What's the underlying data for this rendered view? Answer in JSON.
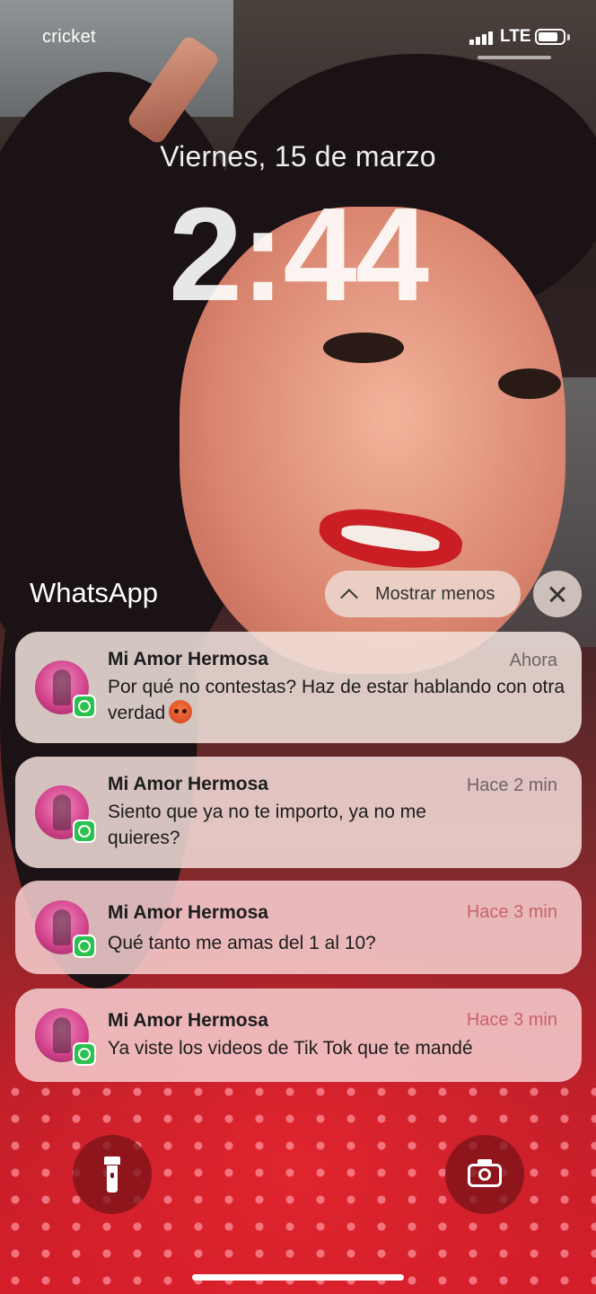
{
  "status_bar": {
    "carrier": "cricket",
    "network": "LTE",
    "signal_bars": 4,
    "battery_level": 0.8
  },
  "lock_screen": {
    "date": "Viernes, 15 de marzo",
    "time": "2:44"
  },
  "notification_group": {
    "app_name": "WhatsApp",
    "show_less_label": "Mostrar menos",
    "close_icon": "close-icon",
    "notifications": [
      {
        "sender": "Mi Amor Hermosa",
        "time": "Ahora",
        "message": "Por qué no contestas? Haz de estar hablando con otra verdad",
        "emoji": "angry-face-emoji"
      },
      {
        "sender": "Mi Amor Hermosa",
        "time": "Hace 2 min",
        "message": "Siento que ya no te importo, ya no me quieres?"
      },
      {
        "sender": "Mi Amor Hermosa",
        "time": "Hace 3 min",
        "message": "Qué tanto me amas del 1 al 10?"
      },
      {
        "sender": "Mi Amor Hermosa",
        "time": "Hace 3 min",
        "message": "Ya viste los videos de Tik Tok que te mandé"
      }
    ]
  },
  "quick_actions": {
    "left_icon": "flashlight-icon",
    "right_icon": "camera-icon"
  },
  "colors": {
    "whatsapp_green": "#2ac14f",
    "quick_action_bg": "#781218"
  }
}
